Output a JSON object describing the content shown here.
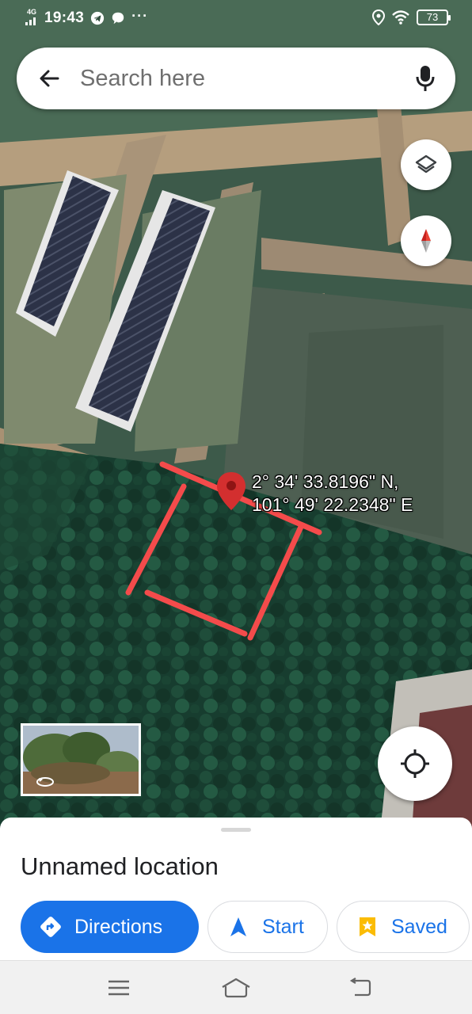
{
  "status_bar": {
    "network": "4G",
    "time": "19:43",
    "notification_icons": [
      "telegram-icon",
      "chat-bubble-icon"
    ],
    "more": "···",
    "battery": "73"
  },
  "search": {
    "placeholder": "Search here"
  },
  "map": {
    "coordinates_line1": "2° 34' 33.8196\" N,",
    "coordinates_line2": "101° 49' 22.2348\" E",
    "accent": "#1a73e8",
    "pin_color": "#d32f2f",
    "annotation_color": "#f44b4b"
  },
  "place": {
    "title": "Unnamed location"
  },
  "actions": [
    {
      "label": "Directions",
      "icon": "directions-icon"
    },
    {
      "label": "Start",
      "icon": "navigation-arrow-icon"
    },
    {
      "label": "Saved",
      "icon": "bookmark-star-icon"
    }
  ]
}
